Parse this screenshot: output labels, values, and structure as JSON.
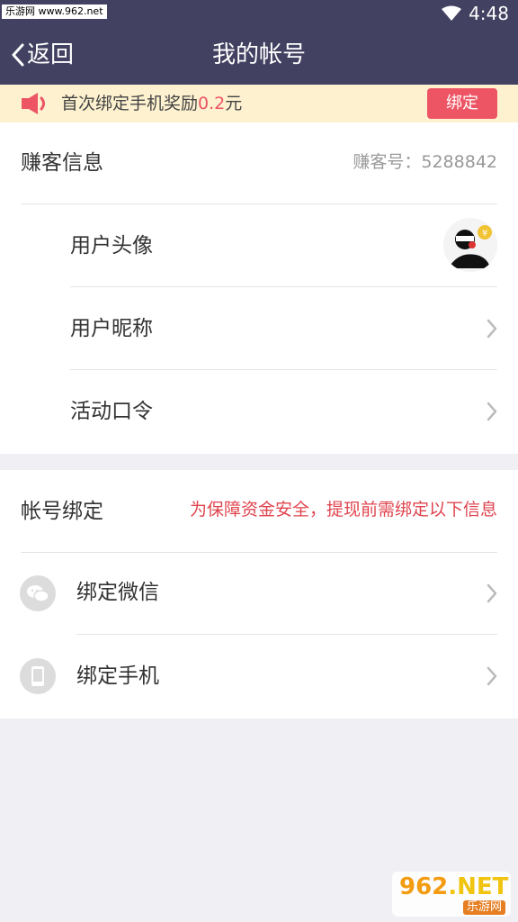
{
  "status_bar": {
    "watermark": "乐游网 www.962.net",
    "time": "4:48"
  },
  "nav": {
    "back_label": "返回",
    "title": "我的帐号"
  },
  "banner": {
    "text_prefix": "首次绑定手机奖励",
    "amount": "0.2",
    "unit": "元",
    "button_label": "绑定"
  },
  "earner_info": {
    "title": "赚客信息",
    "id_text": "赚客号：5288842",
    "rows": [
      {
        "label": "用户头像"
      },
      {
        "label": "用户昵称"
      },
      {
        "label": "活动口令"
      }
    ]
  },
  "account_binding": {
    "title": "帐号绑定",
    "notice": "为保障资金安全，提现前需绑定以下信息",
    "rows": [
      {
        "label": "绑定微信",
        "icon": "wechat-icon"
      },
      {
        "label": "绑定手机",
        "icon": "phone-icon"
      }
    ]
  },
  "footer_watermark": {
    "brand_main": "962",
    "brand_suffix": ".NET",
    "brand_cn": "乐游网"
  },
  "colors": {
    "nav_bg": "#434161",
    "accent_red": "#ed5564",
    "banner_bg": "#fdf1cf",
    "page_bg": "#efeff4"
  }
}
